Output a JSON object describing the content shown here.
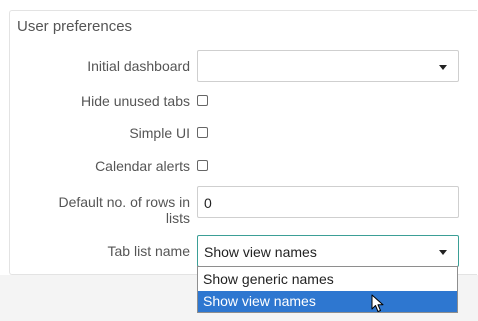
{
  "section_title": "User preferences",
  "fields": {
    "initial_dashboard": {
      "label": "Initial dashboard",
      "value": ""
    },
    "hide_unused_tabs": {
      "label": "Hide unused tabs",
      "checked": false
    },
    "simple_ui": {
      "label": "Simple UI",
      "checked": false
    },
    "calendar_alerts": {
      "label": "Calendar alerts",
      "checked": false
    },
    "default_rows": {
      "label_line1": "Default no. of rows in",
      "label_line2": "lists",
      "value": "0"
    },
    "tab_list_name": {
      "label": "Tab list name",
      "value": "Show view names",
      "options": [
        "Show generic names",
        "Show view names"
      ],
      "selected_index": 1
    }
  },
  "icons": {
    "caret": "chevron-down-icon",
    "cursor": "mouse-pointer-icon"
  },
  "colors": {
    "focus_border": "#3b9f96",
    "option_highlight": "#2e77d0"
  }
}
